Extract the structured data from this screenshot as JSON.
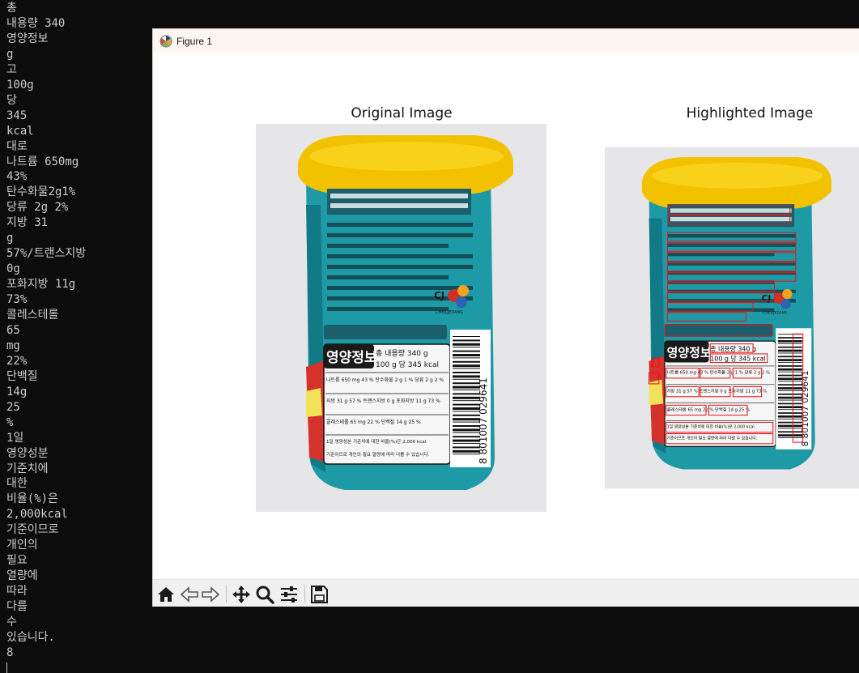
{
  "terminal": {
    "lines": [
      "총",
      "내용량 340",
      "영양정보",
      "g",
      "고",
      "100g",
      "당",
      "345",
      "kcal",
      "대로",
      "나트륨 650mg",
      "43%",
      "탄수화물2g1%",
      "당류 2g 2%",
      "지방 31",
      "g",
      "57%/트랜스지방",
      "0g",
      "포화지방 11g",
      "73%",
      "콜레스테롤",
      "65",
      "mg",
      "22%",
      "단백질",
      "14g",
      "25",
      "%",
      "1일",
      "영양성분",
      "기준치에",
      "대한",
      "비율(%)은",
      "2,000kcal",
      "기준이므로",
      "개인의",
      "필요",
      "열량에",
      "따라",
      "다를",
      "수",
      "있습니다.",
      "8"
    ]
  },
  "window": {
    "title": "Figure 1",
    "app_icon": "matplotlib-icon"
  },
  "figure": {
    "left_title": "Original Image",
    "right_title": "Highlighted Image",
    "can_label": {
      "panel_heading": "영양정보",
      "serving": "총 내용량 340 g",
      "per": "100 g 당 345 kcal",
      "row1": "나트륨 650 mg 43 %  탄수화물 2 g 1 %  당류 2 g 2 %",
      "row2": "지방 31 g 57 %  트랜스지방 0 g  포화지방 11 g 73 %",
      "row3": "콜레스테롤 65 mg 22 %  단백질 14 g 25 %",
      "note1": "1일 영양성분 기준치에 대한 비율(%)은 2,000 kcal",
      "note2": "기준이므로 개인의 필요 열량에 따라 다를 수 있습니다.",
      "brand": "CJ",
      "brand_sub": "CHEILJEDANG",
      "barcode_number": "8 801007 029641"
    },
    "highlight_color": "#e8151b",
    "can_teal": "#1e9aa6",
    "lid_yellow": "#f2c200"
  },
  "toolbar": {
    "tools": [
      {
        "name": "home-icon",
        "label": "Home"
      },
      {
        "name": "back-icon",
        "label": "Back"
      },
      {
        "name": "forward-icon",
        "label": "Forward"
      },
      {
        "name": "pan-icon",
        "label": "Pan"
      },
      {
        "name": "zoom-icon",
        "label": "Zoom"
      },
      {
        "name": "configure-subplots-icon",
        "label": "Configure subplots"
      },
      {
        "name": "save-icon",
        "label": "Save"
      }
    ]
  }
}
